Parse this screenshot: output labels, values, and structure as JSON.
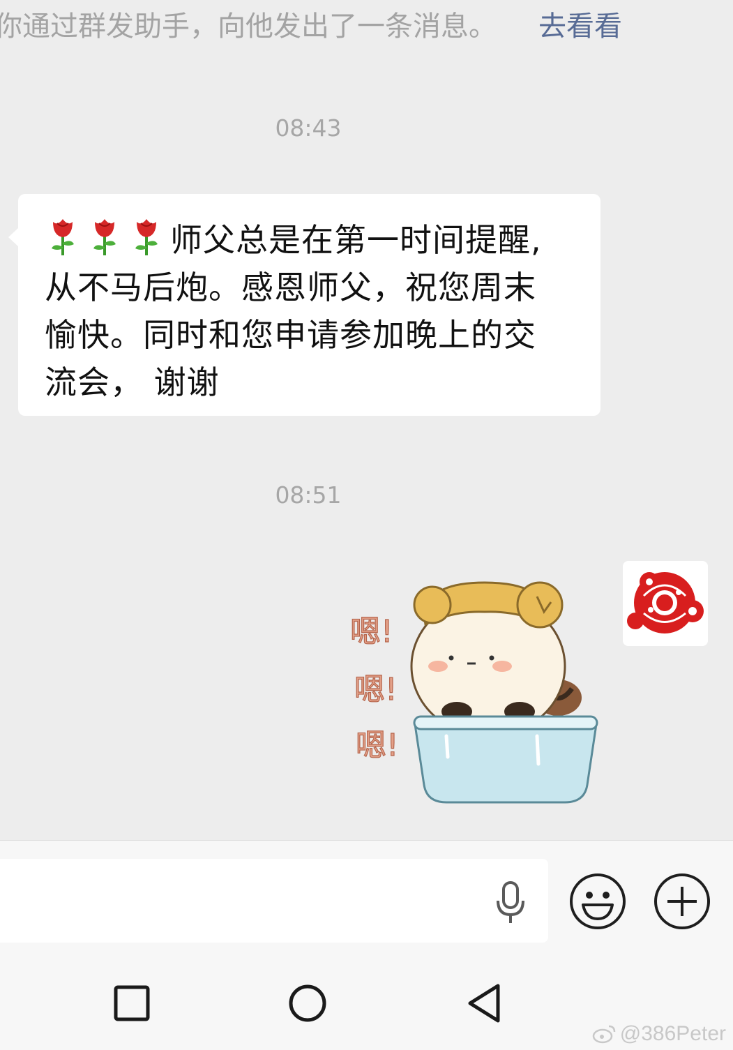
{
  "system_notice": {
    "text": "你通过群发助手，向他发出了一条消息。",
    "link": "去看看"
  },
  "messages": [
    {
      "type": "time",
      "text": "08:43"
    },
    {
      "type": "text",
      "direction": "incoming",
      "emoji": "rose",
      "lines": [
        "师父总是在第一时间提醒,",
        "从不马后炮。感恩师父，祝您周末",
        "愉快。同时和您申请参加晚上的交",
        "流会， 谢谢"
      ]
    },
    {
      "type": "time",
      "text": "08:51"
    },
    {
      "type": "sticker",
      "direction": "outgoing",
      "sticker_text": [
        "嗯!",
        "嗯!",
        "嗯!"
      ],
      "avatar": "paper-cut-avatar"
    }
  ],
  "input_bar": {
    "input_value": "",
    "voice_icon": "microphone-icon",
    "emoji_icon": "smiley-icon",
    "more_icon": "plus-circle-icon"
  },
  "nav_bar": {
    "buttons": [
      "recent-apps-icon",
      "home-icon",
      "back-icon"
    ]
  },
  "watermark": "@386Peter",
  "colors": {
    "background": "#ededed",
    "bubble": "#ffffff",
    "link": "#576b95",
    "muted": "#a3a3a3"
  }
}
